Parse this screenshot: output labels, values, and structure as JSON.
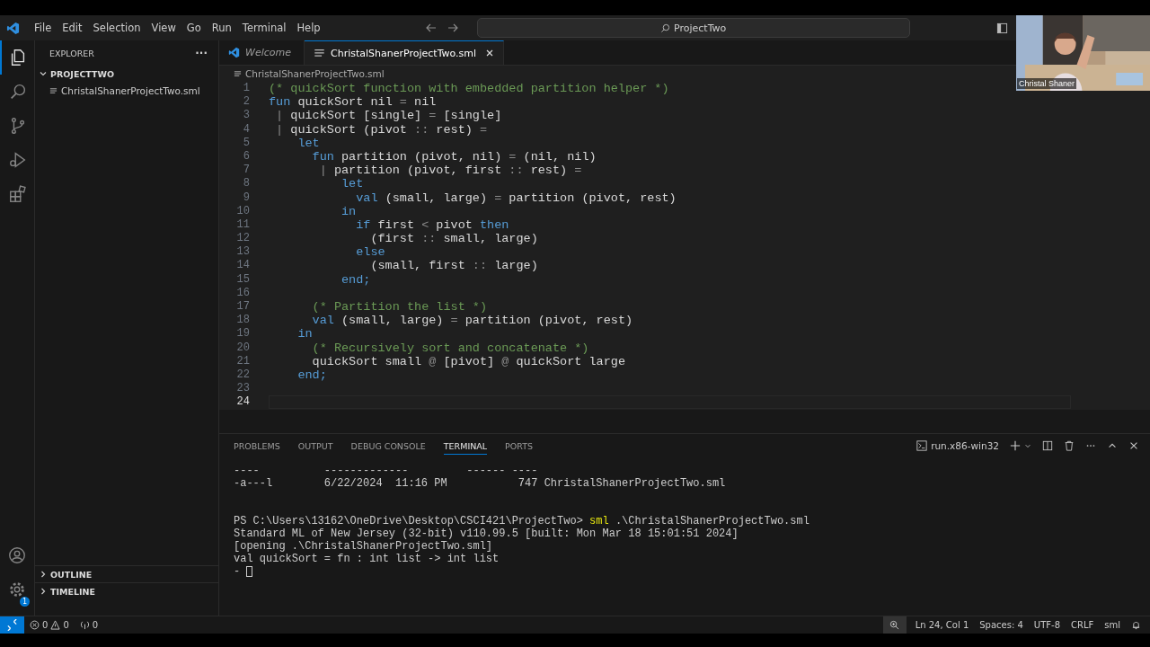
{
  "menu": [
    "File",
    "Edit",
    "Selection",
    "View",
    "Go",
    "Run",
    "Terminal",
    "Help"
  ],
  "command_center": {
    "value": "ProjectTwo"
  },
  "activity_bar": [
    {
      "kind": "explorer",
      "selected": true
    },
    {
      "kind": "search",
      "selected": false
    },
    {
      "kind": "source-control",
      "selected": false
    },
    {
      "kind": "run",
      "selected": false
    },
    {
      "kind": "extensions",
      "selected": false
    }
  ],
  "settings_badge": "1",
  "sidebar": {
    "title": "EXPLORER",
    "more": "···",
    "folder": {
      "name": "PROJECTTWO",
      "expanded": true,
      "files": [
        "ChristalShanerProjectTwo.sml"
      ]
    },
    "sections": [
      {
        "name": "OUTLINE",
        "expanded": false
      },
      {
        "name": "TIMELINE",
        "expanded": false
      }
    ]
  },
  "tabs": [
    {
      "label": "Welcome",
      "kind": "welcome",
      "selected": false
    },
    {
      "label": "ChristalShanerProjectTwo.sml",
      "kind": "file",
      "selected": true
    }
  ],
  "breadcrumb": "ChristalShanerProjectTwo.sml",
  "code": [
    {
      "number": "1",
      "tokens": [
        {
          "text": "(* quickSort function with embedded partition helper *)",
          "kind": "cm"
        }
      ]
    },
    {
      "number": "2",
      "tokens": [
        {
          "text": "fun",
          "kind": "kw"
        },
        {
          "text": " quickSort nil ",
          "kind": "tx"
        },
        {
          "text": "=",
          "kind": "op"
        },
        {
          "text": " nil",
          "kind": "tx"
        }
      ]
    },
    {
      "number": "3",
      "tokens": [
        {
          "text": " | ",
          "kind": "op"
        },
        {
          "text": "quickSort [single] ",
          "kind": "tx"
        },
        {
          "text": "=",
          "kind": "op"
        },
        {
          "text": " [single]",
          "kind": "tx"
        }
      ]
    },
    {
      "number": "4",
      "tokens": [
        {
          "text": " | ",
          "kind": "op"
        },
        {
          "text": "quickSort (pivot ",
          "kind": "tx"
        },
        {
          "text": "::",
          "kind": "op"
        },
        {
          "text": " rest) ",
          "kind": "tx"
        },
        {
          "text": "=",
          "kind": "op"
        }
      ]
    },
    {
      "number": "5",
      "tokens": [
        {
          "text": "    let",
          "kind": "kw"
        }
      ]
    },
    {
      "number": "6",
      "tokens": [
        {
          "text": "      fun",
          "kind": "kw"
        },
        {
          "text": " partition (pivot, nil) ",
          "kind": "tx"
        },
        {
          "text": "=",
          "kind": "op"
        },
        {
          "text": " (nil, nil)",
          "kind": "tx"
        }
      ]
    },
    {
      "number": "7",
      "tokens": [
        {
          "text": "       | ",
          "kind": "op"
        },
        {
          "text": "partition (pivot, first ",
          "kind": "tx"
        },
        {
          "text": "::",
          "kind": "op"
        },
        {
          "text": " rest) ",
          "kind": "tx"
        },
        {
          "text": "=",
          "kind": "op"
        }
      ]
    },
    {
      "number": "8",
      "tokens": [
        {
          "text": "          let",
          "kind": "kw"
        }
      ]
    },
    {
      "number": "9",
      "tokens": [
        {
          "text": "            val",
          "kind": "kw"
        },
        {
          "text": " (small, large) ",
          "kind": "tx"
        },
        {
          "text": "=",
          "kind": "op"
        },
        {
          "text": " partition (pivot, rest)",
          "kind": "tx"
        }
      ]
    },
    {
      "number": "10",
      "tokens": [
        {
          "text": "          in",
          "kind": "kw"
        }
      ]
    },
    {
      "number": "11",
      "tokens": [
        {
          "text": "            if",
          "kind": "kw"
        },
        {
          "text": " first ",
          "kind": "tx"
        },
        {
          "text": "<",
          "kind": "op"
        },
        {
          "text": " pivot ",
          "kind": "tx"
        },
        {
          "text": "then",
          "kind": "kw"
        }
      ]
    },
    {
      "number": "12",
      "tokens": [
        {
          "text": "              (first ",
          "kind": "tx"
        },
        {
          "text": "::",
          "kind": "op"
        },
        {
          "text": " small, large)",
          "kind": "tx"
        }
      ]
    },
    {
      "number": "13",
      "tokens": [
        {
          "text": "            else",
          "kind": "kw"
        }
      ]
    },
    {
      "number": "14",
      "tokens": [
        {
          "text": "              (small, first ",
          "kind": "tx"
        },
        {
          "text": "::",
          "kind": "op"
        },
        {
          "text": " large)",
          "kind": "tx"
        }
      ]
    },
    {
      "number": "15",
      "tokens": [
        {
          "text": "          end;",
          "kind": "kw"
        }
      ]
    },
    {
      "number": "16"
    },
    {
      "number": "17",
      "tokens": [
        {
          "text": "      (* Partition the list *)",
          "kind": "cm"
        }
      ]
    },
    {
      "number": "18",
      "tokens": [
        {
          "text": "      val",
          "kind": "kw"
        },
        {
          "text": " (small, large) ",
          "kind": "tx"
        },
        {
          "text": "=",
          "kind": "op"
        },
        {
          "text": " partition (pivot, rest)",
          "kind": "tx"
        }
      ]
    },
    {
      "number": "19",
      "tokens": [
        {
          "text": "    in",
          "kind": "kw"
        }
      ]
    },
    {
      "number": "20",
      "tokens": [
        {
          "text": "      (* Recursively sort and concatenate *)",
          "kind": "cm"
        }
      ]
    },
    {
      "number": "21",
      "tokens": [
        {
          "text": "      quickSort small ",
          "kind": "tx"
        },
        {
          "text": "@",
          "kind": "op"
        },
        {
          "text": " [pivot] ",
          "kind": "tx"
        },
        {
          "text": "@",
          "kind": "op"
        },
        {
          "text": " quickSort large",
          "kind": "tx"
        }
      ]
    },
    {
      "number": "22",
      "tokens": [
        {
          "text": "    end;",
          "kind": "kw"
        }
      ]
    },
    {
      "number": "23"
    },
    {
      "number": "24",
      "current": true
    }
  ],
  "panel": {
    "tabs": [
      {
        "label": "PROBLEMS",
        "selected": false
      },
      {
        "label": "OUTPUT",
        "selected": false
      },
      {
        "label": "DEBUG CONSOLE",
        "selected": false
      },
      {
        "label": "TERMINAL",
        "selected": true
      },
      {
        "label": "PORTS",
        "selected": false
      }
    ],
    "terminal_name": "run.x86-win32",
    "lines": [
      {
        "kind": "text",
        "text": "----          -------------         ------ ----"
      },
      {
        "kind": "text",
        "text": "-a---l        6/22/2024  11:16 PM           747 ChristalShanerProjectTwo.sml"
      },
      {
        "kind": "gap"
      },
      {
        "kind": "command",
        "prompt": "PS C:\\Users\\13162\\OneDrive\\Desktop\\CSCI421\\ProjectTwo>",
        "command": "sml",
        "args": " .\\ChristalShanerProjectTwo.sml"
      },
      {
        "kind": "text",
        "text": "Standard ML of New Jersey (32-bit) v110.99.5 [built: Mon Mar 18 15:01:51 2024]"
      },
      {
        "kind": "text",
        "text": "[opening .\\ChristalShanerProjectTwo.sml]"
      },
      {
        "kind": "text",
        "text": "val quickSort = fn : int list -> int list"
      },
      {
        "kind": "input",
        "text": "-"
      }
    ]
  },
  "status_bar": {
    "errors": "0",
    "warnings": "0",
    "ports": "0",
    "items": [
      "Ln 24, Col 1",
      "Spaces: 4",
      "UTF-8",
      "CRLF",
      "sml"
    ]
  },
  "webcam": {
    "name": "Christal Shaner"
  }
}
